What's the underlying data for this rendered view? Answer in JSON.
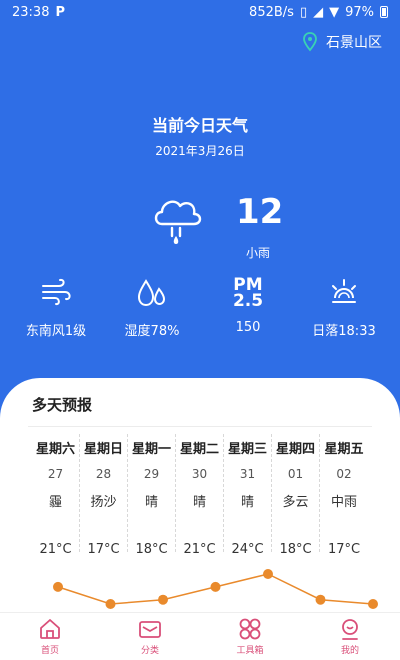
{
  "status": {
    "time": "23:38",
    "app_glyph": "P",
    "speed": "852B/s",
    "battery": "97%"
  },
  "location": {
    "name": "石景山区"
  },
  "header": {
    "title": "当前今日天气",
    "date": "2021年3月26日"
  },
  "current": {
    "temp": "12",
    "condition": "小雨"
  },
  "stats": {
    "wind": "东南风1级",
    "humidity": "湿度78%",
    "pm_label_top": "PM",
    "pm_label_bottom": "2.5",
    "pm_value": "150",
    "sunset": "日落18:33"
  },
  "forecast": {
    "title": "多天预报",
    "days": [
      {
        "name": "星期六",
        "date": "27",
        "cond": "霾",
        "temp": "21°C"
      },
      {
        "name": "星期日",
        "date": "28",
        "cond": "扬沙",
        "temp": "17°C"
      },
      {
        "name": "星期一",
        "date": "29",
        "cond": "晴",
        "temp": "18°C"
      },
      {
        "name": "星期二",
        "date": "30",
        "cond": "晴",
        "temp": "21°C"
      },
      {
        "name": "星期三",
        "date": "31",
        "cond": "晴",
        "temp": "24°C"
      },
      {
        "name": "星期四",
        "date": "01",
        "cond": "多云",
        "temp": "18°C"
      },
      {
        "name": "星期五",
        "date": "02",
        "cond": "中雨",
        "temp": "17°C"
      }
    ],
    "trend_values": [
      21,
      17,
      18,
      21,
      24,
      18,
      17
    ],
    "trend_color": "#e98a2c"
  },
  "tabs": [
    {
      "label": "首页",
      "icon": "home-icon"
    },
    {
      "label": "分类",
      "icon": "mail-icon"
    },
    {
      "label": "工具箱",
      "icon": "flower-icon"
    },
    {
      "label": "我的",
      "icon": "profile-icon"
    }
  ],
  "colors": {
    "primary": "#2f6ee6",
    "tab": "#d94f79"
  }
}
